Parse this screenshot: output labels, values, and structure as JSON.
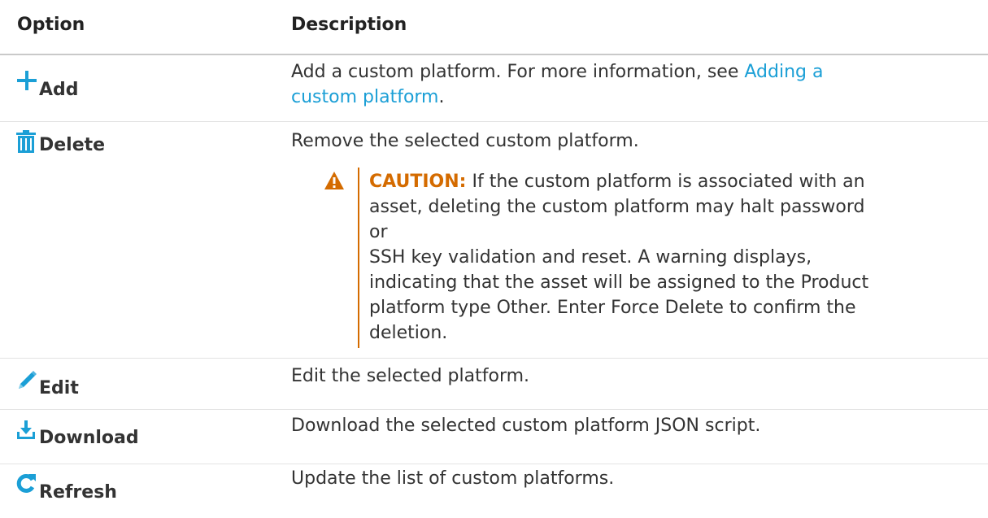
{
  "header": {
    "option": "Option",
    "description": "Description"
  },
  "rows": [
    {
      "icon": "plus-icon",
      "label": "Add",
      "desc_pre": "Add a custom platform. For more information, see ",
      "desc_link_1": "Adding a",
      "desc_link_2": "custom platform",
      "desc_post": "."
    },
    {
      "icon": "trash-icon",
      "label": "Delete",
      "desc": "Remove the selected custom platform.",
      "caution_keyword": "CAUTION:",
      "caution_lines": [
        "If the custom platform is associated with an",
        "asset, deleting the custom platform may halt password or",
        "SSH key validation and reset. A warning displays,",
        "indicating that the asset will be assigned to the Product",
        "platform type Other. Enter Force Delete to confirm the",
        "deletion."
      ]
    },
    {
      "icon": "pencil-icon",
      "label": "Edit",
      "desc": "Edit the selected platform."
    },
    {
      "icon": "download-icon",
      "label": "Download",
      "desc": "Download the selected custom platform JSON script."
    },
    {
      "icon": "refresh-icon",
      "label": "Refresh",
      "desc": "Update the list of custom platforms."
    }
  ],
  "colors": {
    "icon_blue": "#1b9fd6",
    "caution_orange": "#d46b00",
    "link": "#1b9fd6"
  }
}
